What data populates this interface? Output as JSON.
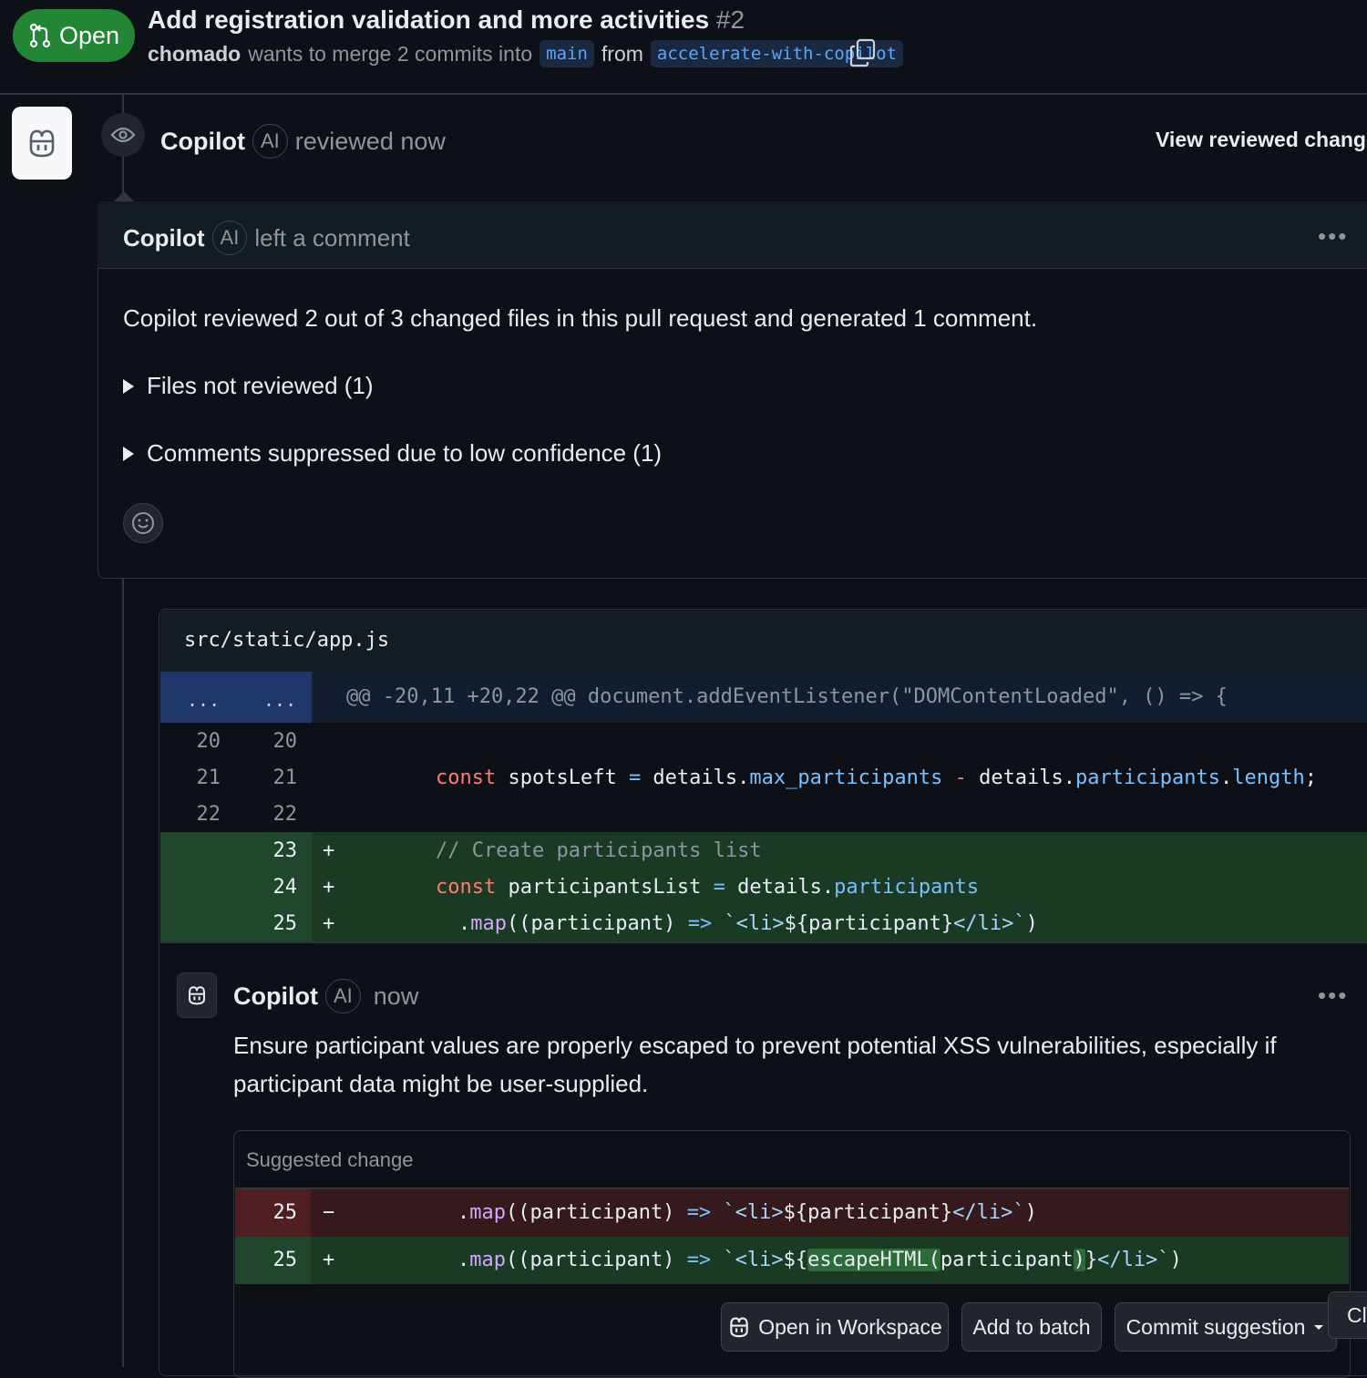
{
  "header": {
    "status": "Open",
    "title": "Add registration validation and more activities",
    "number": "#2",
    "author": "chomado",
    "merge_text": "wants to merge 2 commits into",
    "base_branch": "main",
    "from_text": "from",
    "head_branch": "accelerate-with-copilot"
  },
  "review": {
    "reviewer": "Copilot",
    "ai_badge": "AI",
    "action": "reviewed now",
    "view_link": "View reviewed changes"
  },
  "comment": {
    "author": "Copilot",
    "ai_badge": "AI",
    "action": "left a comment",
    "more": "•••",
    "summary": "Copilot reviewed 2 out of 3 changed files in this pull request and generated 1 comment.",
    "details": [
      "Files not reviewed (1)",
      "Comments suppressed due to low confidence (1)"
    ]
  },
  "diff": {
    "file": "src/static/app.js",
    "hunk_gutter": "...",
    "hunk": "@@ -20,11 +20,22 @@ document.addEventListener(\"DOMContentLoaded\", () => {",
    "lines": [
      {
        "old": "20",
        "new": "20"
      },
      {
        "old": "21",
        "new": "21"
      },
      {
        "old": "22",
        "new": "22"
      },
      {
        "old": "",
        "new": "23",
        "sign": "+"
      },
      {
        "old": "",
        "new": "24",
        "sign": "+"
      },
      {
        "old": "",
        "new": "25",
        "sign": "+"
      }
    ]
  },
  "inline_comment": {
    "author": "Copilot",
    "ai_badge": "AI",
    "time": "now",
    "more": "•••",
    "body": "Ensure participant values are properly escaped to prevent potential XSS vulnerabilities, especially if participant data might be user-supplied."
  },
  "suggestion": {
    "title": "Suggested change",
    "del_line": "25",
    "del_sign": "−",
    "add_line": "25",
    "add_sign": "+"
  },
  "buttons": {
    "open_workspace": "Open in Workspace",
    "add_batch": "Add to batch",
    "commit": "Commit suggestion",
    "partial": "Cl"
  },
  "colors": {
    "open_green": "#238636",
    "accent_blue": "#58a6ff",
    "keyword": "#ff7b72",
    "property": "#79c0ff",
    "function": "#d2a8ff"
  }
}
